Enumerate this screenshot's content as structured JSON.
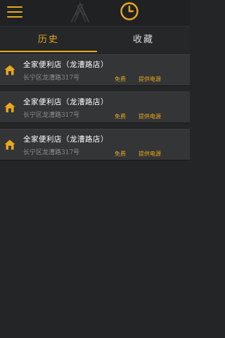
{
  "header": {
    "menu_icon": "hamburger-icon",
    "logo_icon": "logo-icon",
    "clock_icon": "clock-icon",
    "accent_color": "#e9a81a"
  },
  "tabs": [
    {
      "label": "历史",
      "active": true
    },
    {
      "label": "收藏",
      "active": false
    }
  ],
  "stores": [
    {
      "name": "全家便利店（龙漕路店）",
      "address": "长宁区龙漕路317号",
      "tags": [
        "免费",
        "提供电源"
      ]
    },
    {
      "name": "全家便利店（龙漕路店）",
      "address": "长宁区龙漕路317号",
      "tags": [
        "免费",
        "提供电源"
      ]
    },
    {
      "name": "全家便利店（龙漕路店）",
      "address": "长宁区龙漕路317号",
      "tags": [
        "免费",
        "提供电源"
      ]
    }
  ]
}
